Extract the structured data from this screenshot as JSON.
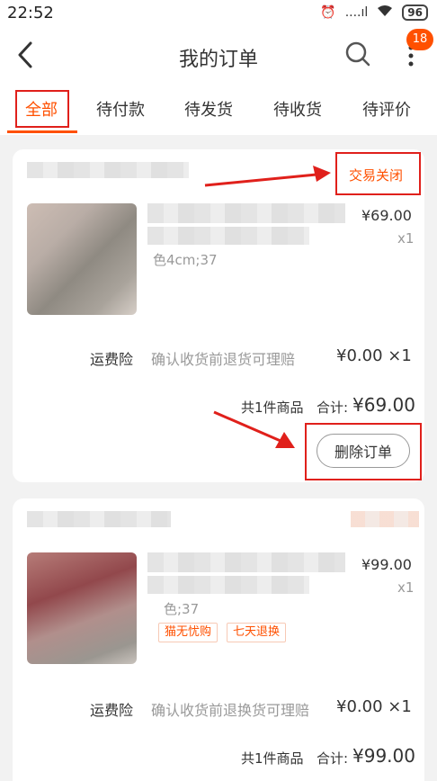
{
  "status_bar": {
    "time": "22:52",
    "signal": "....ıl",
    "battery": "96"
  },
  "header": {
    "title": "我的订单",
    "badge_count": "18"
  },
  "tabs": [
    {
      "label": "全部",
      "active": true
    },
    {
      "label": "待付款",
      "active": false
    },
    {
      "label": "待发货",
      "active": false
    },
    {
      "label": "待收货",
      "active": false
    },
    {
      "label": "待评价",
      "active": false
    }
  ],
  "orders": [
    {
      "status": "交易关闭",
      "item_price": "¥69.00",
      "item_qty": "x1",
      "item_spec": "色4cm;37",
      "insurance_label": "运费险",
      "insurance_desc": "确认收货前退货可理赔",
      "insurance_price": "¥0.00 ×1",
      "summary_count": "共1件商品",
      "summary_total_label": "合计:",
      "summary_total": "¥69.00",
      "action_label": "删除订单"
    },
    {
      "item_price": "¥99.00",
      "item_qty": "x1",
      "item_spec": "色;37",
      "tags": [
        "猫无忧购",
        "七天退换"
      ],
      "insurance_label": "运费险",
      "insurance_desc": "确认收货前退换货可理赔",
      "insurance_price": "¥0.00 ×1",
      "summary_count": "共1件商品",
      "summary_total_label": "合计:",
      "summary_total": "¥99.00"
    }
  ],
  "colors": {
    "accent": "#ff5000",
    "annotation": "#e0201b"
  },
  "icons": [
    "back-arrow-icon",
    "search-icon",
    "more-icon",
    "wifi-icon",
    "alarm-icon"
  ]
}
